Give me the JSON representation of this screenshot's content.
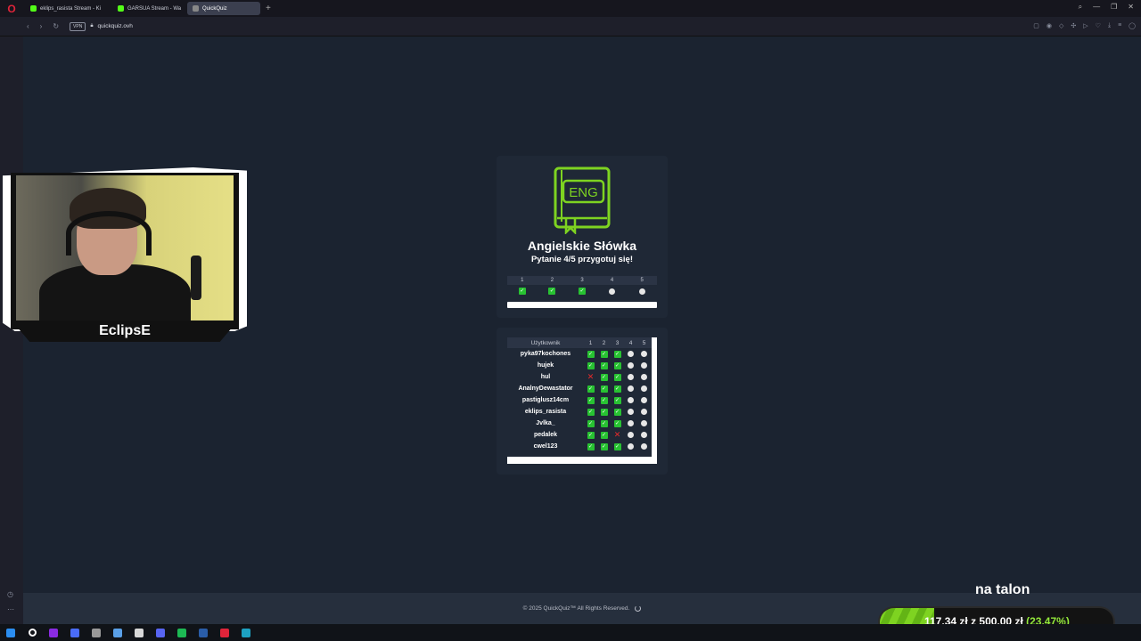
{
  "browser": {
    "tabs": [
      {
        "label": "eklips_rasista Stream - Ki",
        "color": "#53fc18"
      },
      {
        "label": "GARSUA Stream - Wa",
        "color": "#53fc18"
      },
      {
        "label": "QuickQuiz",
        "color": "#888888"
      }
    ],
    "url": "quickquiz.ovh",
    "vpn": "VPN"
  },
  "quiz": {
    "book_label": "ENG",
    "title": "Angielskie Słówka",
    "subtitle": "Pytanie 4/5 przygotuj się!",
    "questions": [
      "1",
      "2",
      "3",
      "4",
      "5"
    ],
    "status": [
      "correct",
      "correct",
      "correct",
      "pending",
      "pending"
    ],
    "accent": "#7ed321"
  },
  "leaderboard": {
    "col_user": "Użytkownik",
    "cols": [
      "1",
      "2",
      "3",
      "4",
      "5"
    ],
    "rows": [
      {
        "name": "pyka97kochones",
        "res": [
          "c",
          "c",
          "c",
          "p",
          "p"
        ]
      },
      {
        "name": "hujek",
        "res": [
          "c",
          "c",
          "c",
          "p",
          "p"
        ]
      },
      {
        "name": "hul",
        "res": [
          "x",
          "c",
          "c",
          "p",
          "p"
        ]
      },
      {
        "name": "AnalnyDewastator",
        "res": [
          "c",
          "c",
          "c",
          "p",
          "p"
        ]
      },
      {
        "name": "pastiglusz14cm",
        "res": [
          "c",
          "c",
          "c",
          "p",
          "p"
        ]
      },
      {
        "name": "eklips_rasista",
        "res": [
          "c",
          "c",
          "c",
          "p",
          "p"
        ]
      },
      {
        "name": "Jvlka_",
        "res": [
          "c",
          "c",
          "c",
          "p",
          "p"
        ]
      },
      {
        "name": "pedalek",
        "res": [
          "c",
          "c",
          "x",
          "p",
          "p"
        ]
      },
      {
        "name": "cwel123",
        "res": [
          "c",
          "c",
          "c",
          "p",
          "p"
        ]
      }
    ]
  },
  "footer": {
    "copyright": "© 2025 QuickQuiz™ All Rights Reserved."
  },
  "stream": {
    "streamer_name": "EclipsE",
    "goal_label": "na talon",
    "goal_current": "117,34 zł",
    "goal_sep": "z",
    "goal_target": "500,00 zł",
    "goal_percent": "(23.47%)",
    "goal_fraction": 0.2347
  },
  "taskbar": {
    "icons": [
      "windows-icon",
      "search-icon",
      "app-icon",
      "app-icon",
      "app-icon",
      "app-icon",
      "app-icon",
      "discord-icon",
      "spotify-icon",
      "steam-icon",
      "opera-icon",
      "app-icon"
    ],
    "colors": [
      "#2b8ef0",
      "#ffffff",
      "#8a2be2",
      "#4a6cf7",
      "#999999",
      "#5aa0e8",
      "#d8d8d8",
      "#5865f2",
      "#1db954",
      "#2a5da8",
      "#e0243a",
      "#1da1c1"
    ]
  }
}
